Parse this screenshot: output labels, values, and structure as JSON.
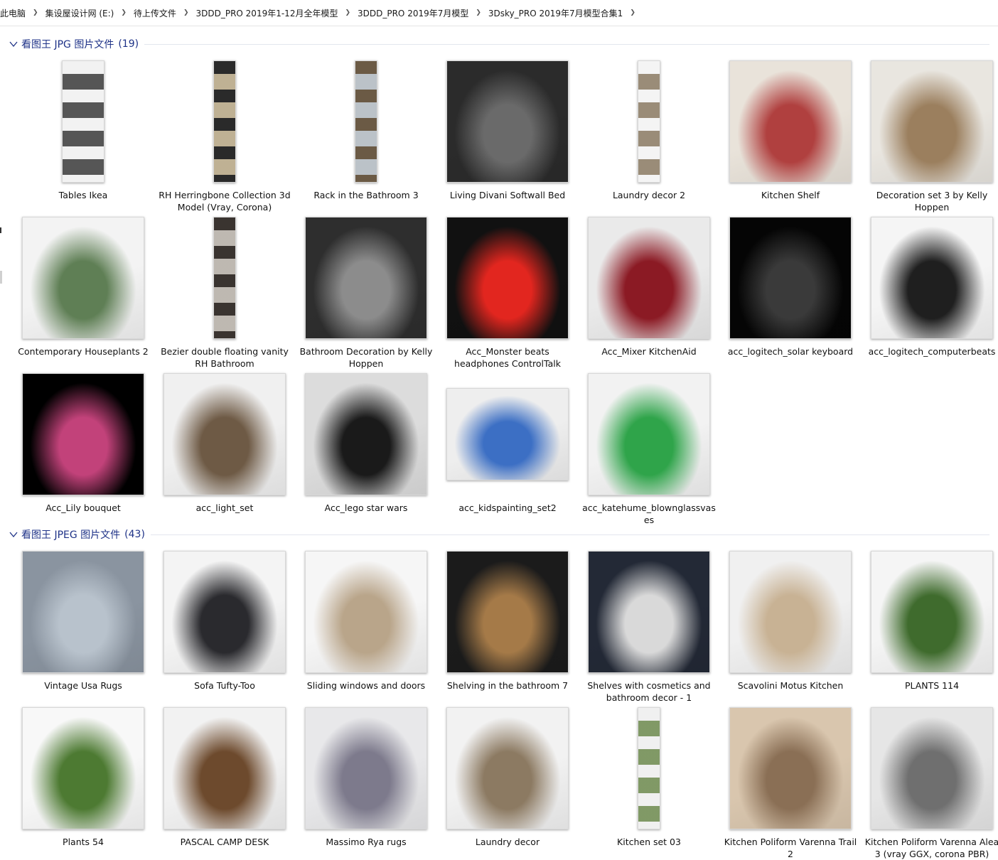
{
  "breadcrumb": [
    "此电脑",
    "集设屋设计网 (E:)",
    "待上传文件",
    "3DDD_PRO 2019年1-12月全年模型",
    "3DDD_PRO 2019年7月模型",
    "3Dsky_PRO 2019年7月模型合集1"
  ],
  "groups": [
    {
      "title": "看图王 JPG 图片文件",
      "count": "(19)",
      "items": [
        {
          "label": "Tables Ikea",
          "shape": "tall",
          "colors": [
            "#f2f2f2",
            "#3a3a3a"
          ]
        },
        {
          "label": "RH Herringbone Collection 3d Model (Vray, Corona)",
          "shape": "narrow",
          "colors": [
            "#2a2a2a",
            "#d9c9a6"
          ]
        },
        {
          "label": "Rack in the Bathroom 3",
          "shape": "narrow",
          "colors": [
            "#6b5a45",
            "#c9d4df"
          ]
        },
        {
          "label": "Living Divani Softwall Bed",
          "shape": "square",
          "colors": [
            "#2b2b2b",
            "#6a6a6a"
          ]
        },
        {
          "label": "Laundry decor 2",
          "shape": "narrow",
          "colors": [
            "#f4f4f4",
            "#8a7a62"
          ]
        },
        {
          "label": "Kitchen Shelf",
          "shape": "square",
          "colors": [
            "#e9e3da",
            "#b0403f"
          ]
        },
        {
          "label": "Decoration set 3 by Kelly Hoppen",
          "shape": "square",
          "colors": [
            "#e9e6e0",
            "#9b7f5e"
          ]
        },
        {
          "label": "Contemporary Houseplants 2",
          "shape": "square",
          "colors": [
            "#f3f3f3",
            "#5f7f55"
          ]
        },
        {
          "label": "Bezier double floating vanity RH Bathroom",
          "shape": "narrow",
          "colors": [
            "#3a3430",
            "#d5d0c8"
          ]
        },
        {
          "label": "Bathroom Decoration by Kelly Hoppen",
          "shape": "square",
          "colors": [
            "#2e2e2e",
            "#8c8c8c"
          ]
        },
        {
          "label": "Acc_Monster beats headphones ControlTalk",
          "shape": "square",
          "colors": [
            "#111111",
            "#e2261f"
          ]
        },
        {
          "label": "Acc_Mixer KitchenAid",
          "shape": "square",
          "colors": [
            "#eaeaea",
            "#8b1a24"
          ]
        },
        {
          "label": "acc_logitech_solar keyboard",
          "shape": "square",
          "colors": [
            "#050505",
            "#3a3a3a"
          ]
        },
        {
          "label": "acc_logitech_computerbeats",
          "shape": "square",
          "colors": [
            "#f5f5f5",
            "#1f1f1f"
          ]
        },
        {
          "label": "Acc_Lily bouquet",
          "shape": "square",
          "colors": [
            "#000000",
            "#c2427a"
          ]
        },
        {
          "label": "acc_light_set",
          "shape": "square",
          "colors": [
            "#f0f0f0",
            "#6e5a45"
          ]
        },
        {
          "label": "Acc_lego star wars",
          "shape": "square",
          "colors": [
            "#dcdcdc",
            "#1a1a1a"
          ]
        },
        {
          "label": "acc_kidspainting_set2",
          "shape": "wide",
          "colors": [
            "#eeeeee",
            "#3c6fc4"
          ]
        },
        {
          "label": "acc_katehume_blownglassvases",
          "shape": "square",
          "colors": [
            "#f2f2f2",
            "#2fa44a"
          ]
        }
      ]
    },
    {
      "title": "看图王 JPEG 图片文件",
      "count": "(43)",
      "items": [
        {
          "label": "Vintage Usa Rugs",
          "shape": "square",
          "colors": [
            "#8a94a0",
            "#b8c2cc"
          ]
        },
        {
          "label": "Sofa Tufty-Too",
          "shape": "square",
          "colors": [
            "#f4f4f4",
            "#2a2a2e"
          ]
        },
        {
          "label": "Sliding windows and doors",
          "shape": "square",
          "colors": [
            "#f6f6f6",
            "#b9a58a"
          ]
        },
        {
          "label": "Shelving in the bathroom 7",
          "shape": "square",
          "colors": [
            "#1b1b1b",
            "#a57a48"
          ]
        },
        {
          "label": "Shelves with cosmetics and bathroom decor - 1",
          "shape": "square",
          "colors": [
            "#232936",
            "#d9d9d9"
          ]
        },
        {
          "label": "Scavolini Motus Kitchen",
          "shape": "square",
          "colors": [
            "#f0f0f0",
            "#c8b294"
          ]
        },
        {
          "label": "PLANTS 114",
          "shape": "square",
          "colors": [
            "#f5f5f5",
            "#3f6b2d"
          ]
        },
        {
          "label": "Plants 54",
          "shape": "square",
          "colors": [
            "#f8f8f8",
            "#4d7a32"
          ]
        },
        {
          "label": "PASCAL CAMP DESK",
          "shape": "square",
          "colors": [
            "#f2f2f2",
            "#6d4a2d"
          ]
        },
        {
          "label": "Massimo Rya rugs",
          "shape": "square",
          "colors": [
            "#e8e8ea",
            "#7d7a8c"
          ]
        },
        {
          "label": "Laundry decor",
          "shape": "square",
          "colors": [
            "#f2f2f2",
            "#8c7a62"
          ]
        },
        {
          "label": "Kitchen set 03",
          "shape": "narrow",
          "colors": [
            "#f0f0f0",
            "#6d8a4e"
          ]
        },
        {
          "label": "Kitchen Poliform Varenna Trail 2",
          "shape": "square",
          "colors": [
            "#d9c6ae",
            "#8a6f55"
          ]
        },
        {
          "label": "Kitchen Poliform Varenna Alea 3 (vray GGX, corona PBR)",
          "shape": "square",
          "colors": [
            "#e6e6e6",
            "#6f6f6f"
          ]
        }
      ]
    }
  ],
  "colors": {
    "header_text": "#1e3287",
    "breadcrumb_border": "#e5e5e5"
  }
}
